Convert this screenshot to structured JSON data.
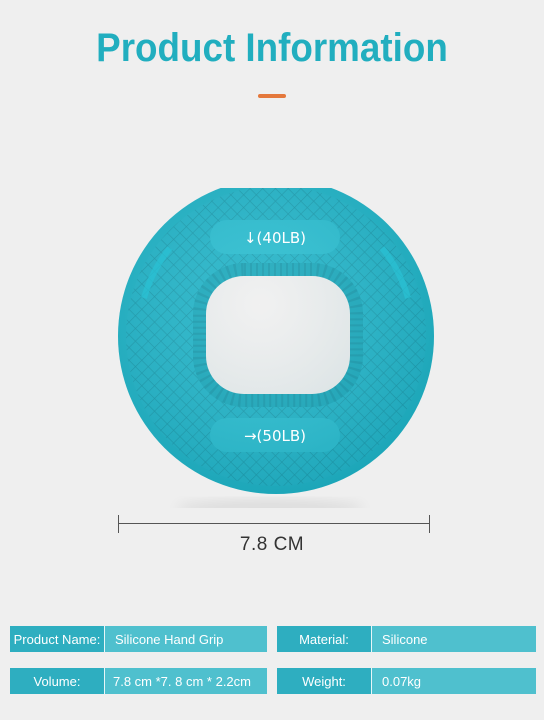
{
  "header": {
    "title": "Product Information"
  },
  "product": {
    "upper_label": "↓(40LB)",
    "lower_label": "→(50LB)",
    "color": "#1fb3c6"
  },
  "dimension": {
    "label": "7.8 CM"
  },
  "specs": {
    "product_name": {
      "key": "Product Name:",
      "value": "Silicone Hand Grip"
    },
    "material": {
      "key": "Material:",
      "value": "Silicone"
    },
    "volume": {
      "key": "Volume:",
      "value": "7.8 cm *7. 8 cm * 2.2cm"
    },
    "weight": {
      "key": "Weight:",
      "value": "0.07kg"
    }
  },
  "colors": {
    "accent": "#21aebf",
    "rule": "#e4783c",
    "spec_key_bg": "#2eaec0",
    "spec_value_bg": "#4fc0ce",
    "background": "#efefef"
  }
}
